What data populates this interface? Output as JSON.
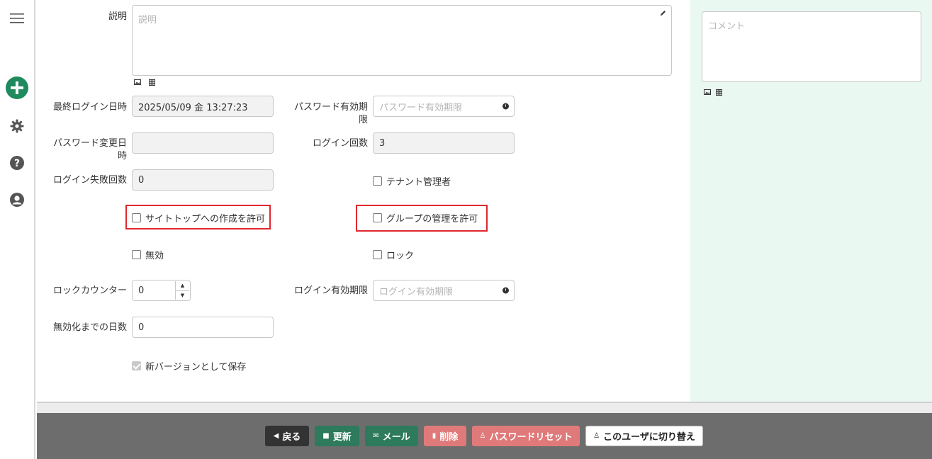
{
  "rail": {
    "icons": [
      "menu-icon",
      "add-icon",
      "gear-icon",
      "help-icon",
      "user-icon"
    ]
  },
  "form": {
    "description": {
      "label": "説明",
      "placeholder": "説明"
    },
    "last_login": {
      "label": "最終ログイン日時",
      "value": "2025/05/09 金 13:27:23"
    },
    "password_expiry": {
      "label_line1": "パスワード有効期",
      "label_line2": "限",
      "placeholder": "パスワード有効期限"
    },
    "password_changed": {
      "label_line1": "パスワード変更日",
      "label_line2": "時",
      "value": ""
    },
    "login_count": {
      "label": "ログイン回数",
      "value": "3"
    },
    "login_failures": {
      "label": "ログイン失敗回数",
      "value": "0"
    },
    "tenant_admin": {
      "label": "テナント管理者",
      "checked": false
    },
    "allow_site_top": {
      "label": "サイトトップへの作成を許可",
      "checked": false
    },
    "allow_group_manage": {
      "label": "グループの管理を許可",
      "checked": false
    },
    "disabled": {
      "label": "無効",
      "checked": false
    },
    "lock": {
      "label": "ロック",
      "checked": false
    },
    "lock_counter": {
      "label": "ロックカウンター",
      "value": "0"
    },
    "login_expiry": {
      "label": "ログイン有効期限",
      "placeholder": "ログイン有効期限"
    },
    "days_until_disable": {
      "label": "無効化までの日数",
      "value": "0"
    },
    "save_as_new_version": {
      "label": "新バージョンとして保存",
      "checked": true
    }
  },
  "side": {
    "comment": {
      "placeholder": "コメント"
    }
  },
  "footer": {
    "back": "戻る",
    "update": "更新",
    "mail": "メール",
    "delete": "削除",
    "password_reset": "パスワードリセット",
    "switch_user": "このユーザに切り替え"
  },
  "colors": {
    "accent_green": "#2d7a5c",
    "danger": "#e07a7a",
    "highlight_frame": "#e0282e",
    "side_panel": "#e9f8f1"
  }
}
